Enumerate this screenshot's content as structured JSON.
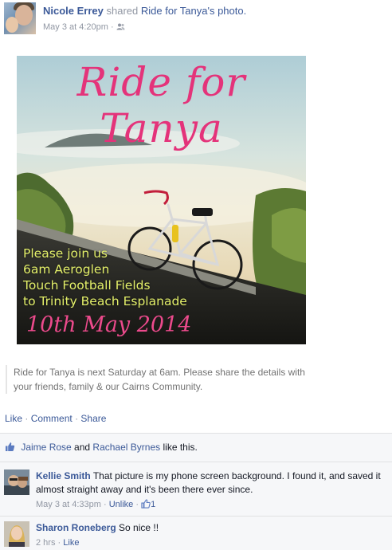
{
  "post": {
    "author": "Nicole Errey",
    "shared_text": "shared",
    "shared_target": "Ride for Tanya",
    "shared_suffix": "'s photo.",
    "timestamp": "May 3 at 4:20pm",
    "meta_sep": "·",
    "privacy_icon": "friends-icon"
  },
  "photo": {
    "title": "Ride for Tanya",
    "lines": [
      "Please join us",
      "6am Aeroglen",
      "Touch Football Fields",
      "to Trinity Beach Esplanade"
    ],
    "date": "10th May 2014"
  },
  "caption": {
    "lines": [
      "Ride for Tanya is next Saturday at 6am. Please share the details with",
      "your friends, family & our Cairns Community."
    ]
  },
  "actions": {
    "like": "Like",
    "comment": "Comment",
    "share": "Share",
    "sep": "·"
  },
  "likes": {
    "user1": "Jaime Rose",
    "and": "and",
    "user2": "Rachael Byrnes",
    "suffix": "like this."
  },
  "comments": [
    {
      "name": "Kellie Smith",
      "text": "That picture is my phone screen background. I found it, and saved it almost straight away and it's been there ever since.",
      "time": "May 3 at 4:33pm",
      "sep": "·",
      "action": "Unlike",
      "like_count": "1"
    },
    {
      "name": "Sharon Roneberg",
      "text": "So nice !!",
      "time": "2 hrs",
      "sep": "·",
      "action": "Like"
    }
  ],
  "colors": {
    "link": "#3b5998",
    "muted": "#9197a3",
    "poster_pink": "#e4337a",
    "poster_yellow": "#e4f06a"
  }
}
